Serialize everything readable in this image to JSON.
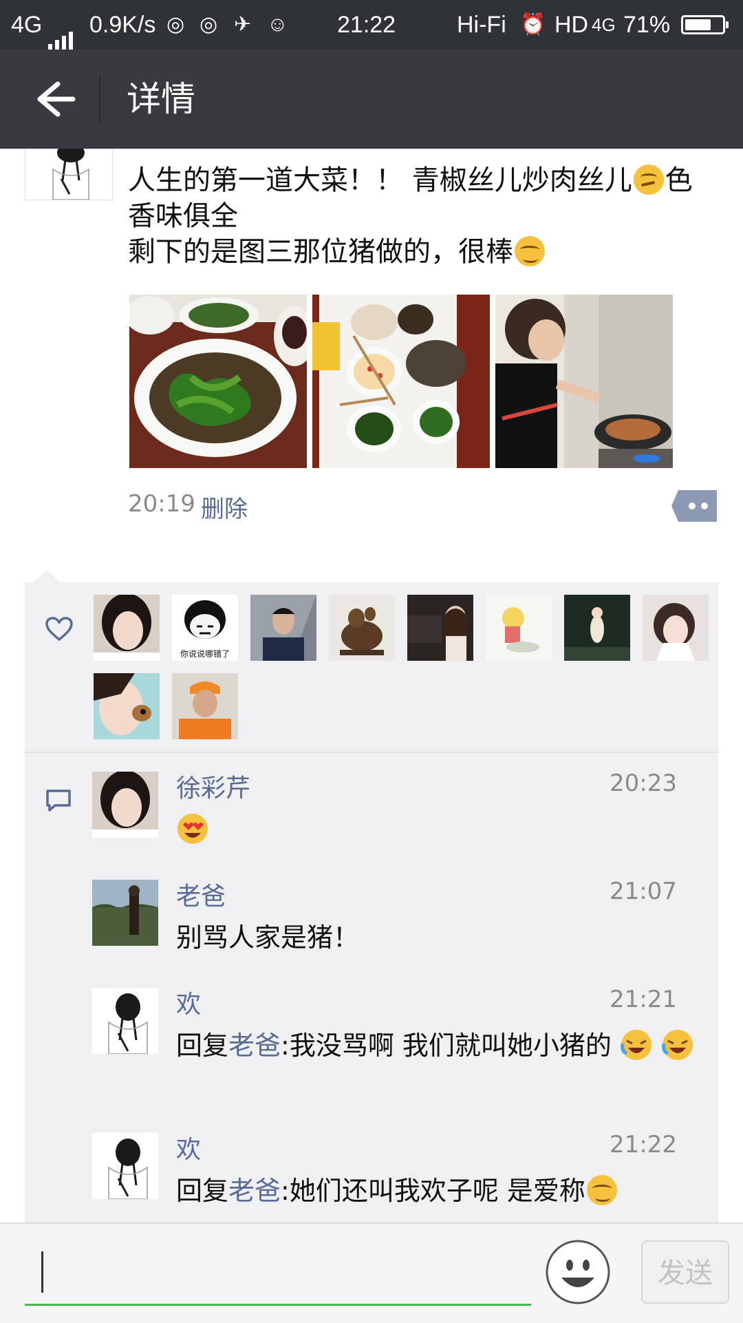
{
  "status_bar": {
    "network": "4G",
    "speed": "0.9K/s",
    "time": "21:22",
    "audio": "Hi-Fi",
    "hd": "HD",
    "net2": "4G",
    "battery": "71%",
    "battery_level": 0.71
  },
  "header": {
    "title": "详情"
  },
  "post": {
    "line1": "人生的第一道大菜！！ 青椒丝儿炒肉丝儿",
    "line1_tail": "色",
    "line2": "香味俱全",
    "line3": "剩下的是图三那位猪做的，很棒",
    "time": "20:19",
    "delete_label": "删除"
  },
  "comments": [
    {
      "name": "徐彩芹",
      "time": "20:23",
      "text": ""
    },
    {
      "name": "老爸",
      "time": "21:07",
      "text": "别骂人家是猪！"
    },
    {
      "name": "欢",
      "time": "21:21",
      "reply_prefix": "回复",
      "reply_to": "老爸",
      "text": ":我没骂啊  我们就叫她小猪的"
    },
    {
      "name": "欢",
      "time": "21:22",
      "reply_prefix": "回复",
      "reply_to": "老爸",
      "text": ":她们还叫我欢子呢   是爱称"
    }
  ],
  "likes": {
    "avatar_2_caption": "你说说哪错了"
  },
  "input": {
    "placeholder": "",
    "send_label": "发送"
  },
  "colors": {
    "accent_link": "#576b95",
    "input_underline": "#44b549",
    "navbar": "#393a3f"
  }
}
